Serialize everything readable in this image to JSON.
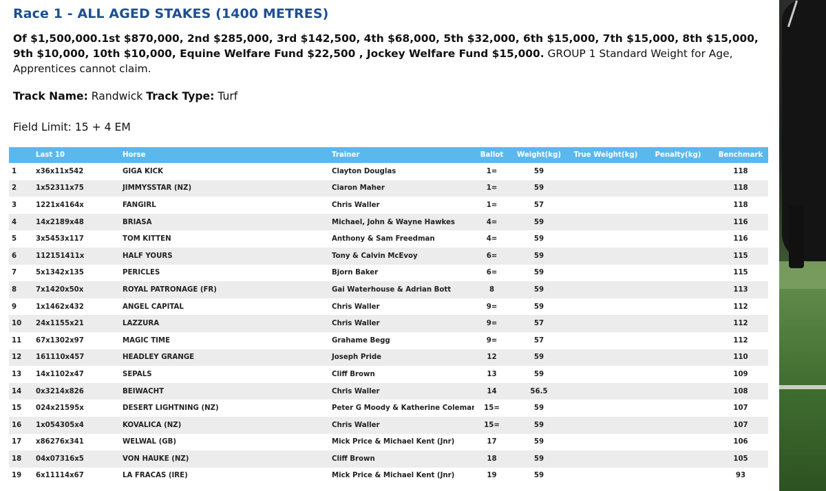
{
  "race": {
    "title": "Race 1 - ALL AGED STAKES (1400 METRES)",
    "prize_bold": "Of $1,500,000.1st $870,000, 2nd $285,000, 3rd $142,500, 4th $68,000, 5th $32,000, 6th $15,000, 7th $15,000, 8th $15,000, 9th $10,000, 10th $10,000, Equine Welfare Fund $22,500 , Jockey Welfare Fund $15,000.",
    "prize_tail": " GROUP 1 Standard Weight for Age, Apprentices cannot claim.",
    "track_name_label": "Track Name:",
    "track_name": " Randwick ",
    "track_type_label": "Track Type:",
    "track_type": " Turf",
    "field_limit": "Field Limit: 15 + 4 EM"
  },
  "table": {
    "headers": {
      "num": "",
      "last10": "Last 10",
      "horse": "Horse",
      "trainer": "Trainer",
      "ballot": "Ballot",
      "weight": "Weight(kg)",
      "true_weight": "True Weight(kg)",
      "penalty": "Penalty(kg)",
      "benchmark": "Benchmark"
    },
    "rows": [
      {
        "num": "1",
        "last10": "x36x11x542",
        "horse": "GIGA KICK",
        "trainer": "Clayton Douglas",
        "ballot": "1=",
        "weight": "59",
        "true_weight": "",
        "penalty": "",
        "benchmark": "118"
      },
      {
        "num": "2",
        "last10": "1x52311x75",
        "horse": "JIMMYSSTAR (NZ)",
        "trainer": "Ciaron Maher",
        "ballot": "1=",
        "weight": "59",
        "true_weight": "",
        "penalty": "",
        "benchmark": "118"
      },
      {
        "num": "3",
        "last10": "1221x4164x",
        "horse": "FANGIRL",
        "trainer": "Chris Waller",
        "ballot": "1=",
        "weight": "57",
        "true_weight": "",
        "penalty": "",
        "benchmark": "118"
      },
      {
        "num": "4",
        "last10": "14x2189x48",
        "horse": "BRIASA",
        "trainer": "Michael, John & Wayne Hawkes",
        "ballot": "4=",
        "weight": "59",
        "true_weight": "",
        "penalty": "",
        "benchmark": "116"
      },
      {
        "num": "5",
        "last10": "3x5453x117",
        "horse": "TOM KITTEN",
        "trainer": "Anthony & Sam Freedman",
        "ballot": "4=",
        "weight": "59",
        "true_weight": "",
        "penalty": "",
        "benchmark": "116"
      },
      {
        "num": "6",
        "last10": "112151411x",
        "horse": "HALF YOURS",
        "trainer": "Tony & Calvin McEvoy",
        "ballot": "6=",
        "weight": "59",
        "true_weight": "",
        "penalty": "",
        "benchmark": "115"
      },
      {
        "num": "7",
        "last10": "5x1342x135",
        "horse": "PERICLES",
        "trainer": "Bjorn Baker",
        "ballot": "6=",
        "weight": "59",
        "true_weight": "",
        "penalty": "",
        "benchmark": "115"
      },
      {
        "num": "8",
        "last10": "7x1420x50x",
        "horse": "ROYAL PATRONAGE (FR)",
        "trainer": "Gai Waterhouse & Adrian Bott",
        "ballot": "8",
        "weight": "59",
        "true_weight": "",
        "penalty": "",
        "benchmark": "113"
      },
      {
        "num": "9",
        "last10": "1x1462x432",
        "horse": "ANGEL CAPITAL",
        "trainer": "Chris Waller",
        "ballot": "9=",
        "weight": "59",
        "true_weight": "",
        "penalty": "",
        "benchmark": "112"
      },
      {
        "num": "10",
        "last10": "24x1155x21",
        "horse": "LAZZURA",
        "trainer": "Chris Waller",
        "ballot": "9=",
        "weight": "57",
        "true_weight": "",
        "penalty": "",
        "benchmark": "112"
      },
      {
        "num": "11",
        "last10": "67x1302x97",
        "horse": "MAGIC TIME",
        "trainer": "Grahame Begg",
        "ballot": "9=",
        "weight": "57",
        "true_weight": "",
        "penalty": "",
        "benchmark": "112"
      },
      {
        "num": "12",
        "last10": "161110x457",
        "horse": "HEADLEY GRANGE",
        "trainer": "Joseph Pride",
        "ballot": "12",
        "weight": "59",
        "true_weight": "",
        "penalty": "",
        "benchmark": "110"
      },
      {
        "num": "13",
        "last10": "14x1102x47",
        "horse": "SEPALS",
        "trainer": "Cliff Brown",
        "ballot": "13",
        "weight": "59",
        "true_weight": "",
        "penalty": "",
        "benchmark": "109"
      },
      {
        "num": "14",
        "last10": "0x3214x826",
        "horse": "BEIWACHT",
        "trainer": "Chris Waller",
        "ballot": "14",
        "weight": "56.5",
        "true_weight": "",
        "penalty": "",
        "benchmark": "108"
      },
      {
        "num": "15",
        "last10": "024x21595x",
        "horse": "DESERT LIGHTNING (NZ)",
        "trainer": "Peter G Moody & Katherine Coleman",
        "ballot": "15=",
        "weight": "59",
        "true_weight": "",
        "penalty": "",
        "benchmark": "107"
      },
      {
        "num": "16",
        "last10": "1x054305x4",
        "horse": "KOVALICA (NZ)",
        "trainer": "Chris Waller",
        "ballot": "15=",
        "weight": "59",
        "true_weight": "",
        "penalty": "",
        "benchmark": "107"
      },
      {
        "num": "17",
        "last10": "x86276x341",
        "horse": "WELWAL (GB)",
        "trainer": "Mick Price & Michael Kent (Jnr)",
        "ballot": "17",
        "weight": "59",
        "true_weight": "",
        "penalty": "",
        "benchmark": "106"
      },
      {
        "num": "18",
        "last10": "04x07316x5",
        "horse": "VON HAUKE (NZ)",
        "trainer": "Cliff Brown",
        "ballot": "18",
        "weight": "59",
        "true_weight": "",
        "penalty": "",
        "benchmark": "105"
      },
      {
        "num": "19",
        "last10": "6x11114x67",
        "horse": "LA FRACAS (IRE)",
        "trainer": "Mick Price & Michael Kent (Jnr)",
        "ballot": "19",
        "weight": "59",
        "true_weight": "",
        "penalty": "",
        "benchmark": "93"
      }
    ]
  },
  "colors": {
    "title": "#1d4f91",
    "header_bg": "#5bb8ec",
    "row_alt": "#ececec"
  }
}
